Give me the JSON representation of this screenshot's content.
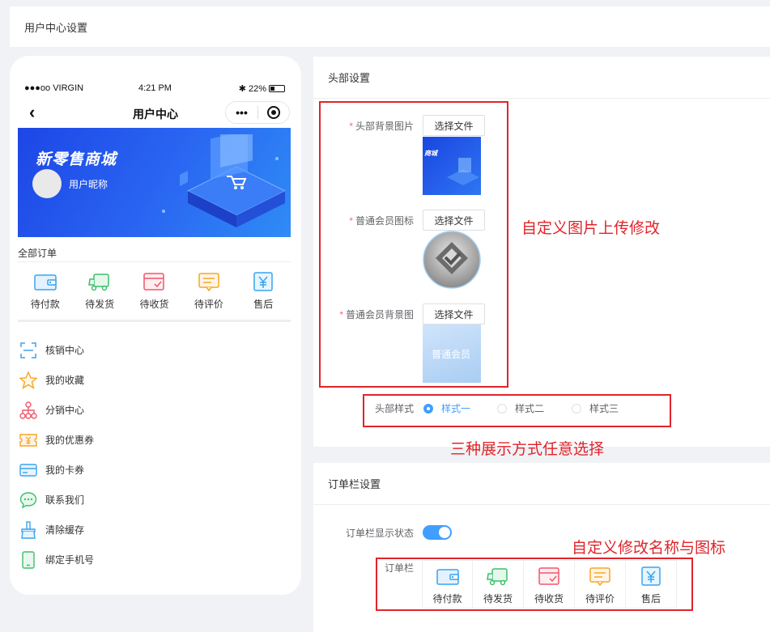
{
  "page": {
    "title": "用户中心设置"
  },
  "phone": {
    "status": {
      "carrier": "●●●oo VIRGIN",
      "time": "4:21 PM",
      "battery": "22%"
    },
    "nav_title": "用户中心",
    "banner": {
      "title": "新零售商城",
      "nickname": "用户昵称"
    },
    "orders_label": "全部订单",
    "orders": [
      {
        "label": "待付款",
        "icon": "wallet-icon"
      },
      {
        "label": "待发货",
        "icon": "truck-icon"
      },
      {
        "label": "待收货",
        "icon": "package-icon"
      },
      {
        "label": "待评价",
        "icon": "comment-icon"
      },
      {
        "label": "售后",
        "icon": "yuan-icon"
      }
    ],
    "menu": [
      {
        "label": "核销中心",
        "icon": "scan-icon"
      },
      {
        "label": "我的收藏",
        "icon": "star-icon"
      },
      {
        "label": "分销中心",
        "icon": "hierarchy-icon"
      },
      {
        "label": "我的优惠券",
        "icon": "coupon-icon"
      },
      {
        "label": "我的卡券",
        "icon": "card-icon"
      },
      {
        "label": "联系我们",
        "icon": "chat-icon"
      },
      {
        "label": "清除缓存",
        "icon": "broom-icon"
      },
      {
        "label": "绑定手机号",
        "icon": "phone-icon"
      }
    ]
  },
  "header_panel": {
    "title": "头部设置",
    "fields": [
      {
        "label": "头部背景图片",
        "button": "选择文件",
        "thumb_text": "商城"
      },
      {
        "label": "普通会员图标",
        "button": "选择文件"
      },
      {
        "label": "普通会员背景图",
        "button": "选择文件",
        "thumb_text": "普通会员"
      }
    ],
    "style_label": "头部样式",
    "style_options": [
      "样式一",
      "样式二",
      "样式三"
    ],
    "selected_style": "样式一"
  },
  "order_panel": {
    "title": "订单栏设置",
    "status_label": "订单栏显示状态",
    "status_on": true,
    "bar_label": "订单栏",
    "items": [
      "待付款",
      "待发货",
      "待收货",
      "待评价",
      "售后"
    ]
  },
  "annotations": {
    "upload": "自定义图片上传修改",
    "styles": "三种展示方式任意选择",
    "order": "自定义修改名称与图标"
  },
  "colors": {
    "accent": "#409eff",
    "annotation": "#e0242a",
    "banner": "#2156ea"
  }
}
